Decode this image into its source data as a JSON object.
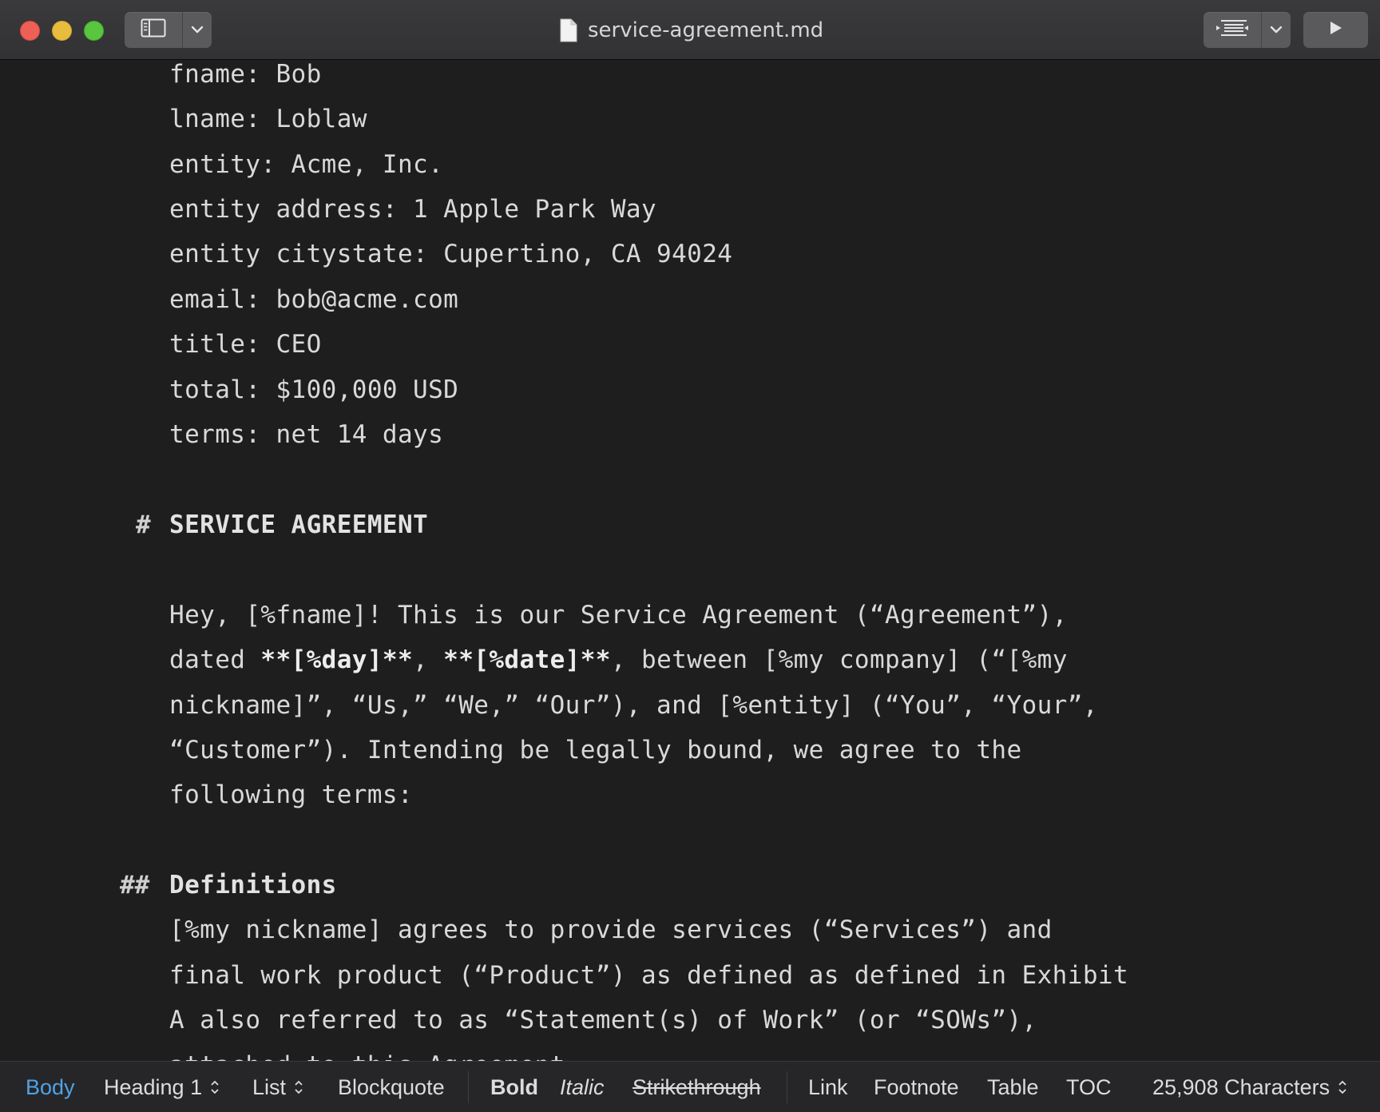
{
  "window": {
    "title": "service-agreement.md",
    "icons": {
      "sidebar": "sidebar-toggle-icon",
      "chevron": "chevron-down-icon",
      "outline": "outline-list-icon",
      "preview": "play-icon",
      "document": "document-icon"
    }
  },
  "editor": {
    "front_matter": [
      "fname: Bob",
      "lname: Loblaw",
      "entity: Acme, Inc.",
      "entity address: 1 Apple Park Way",
      "entity citystate: Cupertino, CA 94024",
      "email: bob@acme.com",
      "title: CEO",
      "total: $100,000 USD",
      "terms: net 14 days"
    ],
    "h1_marker": "#",
    "h1_text": "SERVICE AGREEMENT",
    "intro": {
      "line1": "Hey, [%fname]! This is our Service Agreement (“Agreement”),",
      "line2_a": "dated ",
      "line2_bold1": "**[%day]**",
      "line2_b": ", ",
      "line2_bold2": "**[%date]**",
      "line2_c": ", between [%my company] (“[%my",
      "line3": "nickname]”, “Us,” “We,” “Our”), and [%entity] (“You”, “Your”,",
      "line4": "“Customer”). Intending be legally bound, we agree to the",
      "line5": "following terms:"
    },
    "h2_marker": "##",
    "h2_text": "Definitions",
    "definitions": [
      "[%my nickname] agrees to provide services (“Services”) and",
      "final work product (“Product”) as defined as defined in Exhibit",
      "A also referred to as “Statement(s) of Work” (or “SOWs”),",
      "attached to this Agreement."
    ]
  },
  "toolbar": {
    "body": "Body",
    "heading": "Heading 1",
    "list": "List",
    "blockquote": "Blockquote",
    "bold": "Bold",
    "italic": "Italic",
    "strikethrough": "Strikethrough",
    "link": "Link",
    "footnote": "Footnote",
    "table": "Table",
    "toc": "TOC",
    "char_count": "25,908 Characters",
    "active_color": "#4fa3e8"
  }
}
